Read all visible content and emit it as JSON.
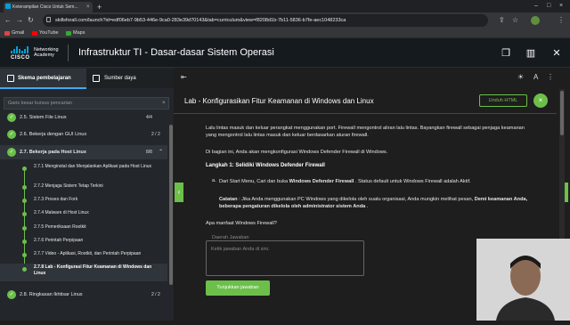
{
  "browser": {
    "tab_title": "Keterampilan Cisco Untuk Sem...",
    "url": "skillsforall.com/launch?id=edf06eb7-9b53-446e-9ca0-283e39d70143&tab=curriculum&view=f8208d1b-7b11-5836-b7fe-aec1048233ca",
    "bookmarks": [
      "Gmail",
      "YouTube",
      "Maps"
    ]
  },
  "header": {
    "logo_brand": "CISCO",
    "logo_sub": "Networking Academy",
    "course_title": "Infrastruktur TI - Dasar-dasar Sistem Operasi"
  },
  "sidebar": {
    "tab_active": "Skema pembelajaran",
    "tab_inactive": "Sumber daya",
    "search_placeholder": "Garis besar kursus pencarian",
    "items": [
      {
        "label": "2.5. Sistem File Linux",
        "count": "4/4"
      },
      {
        "label": "2.6. Bekerja dengan GUI Linux",
        "count": "2 / 2"
      },
      {
        "label": "2.7. Bekerja pada Host Linux",
        "count": "8/8"
      },
      {
        "label": "2.8. Ringkasan Ikhtisar Linux",
        "count": "2 / 2"
      }
    ],
    "subitems": [
      "2.7.1 Menginstal dan Menjalankan Aplikasi pada Host Linux",
      "2.7.2 Menjaga Sistem Tetap Terkini",
      "2.7.3 Proses dan Fork",
      "2.7.4 Malware di Host Linux",
      "2.7.5 Pemeriksaan Rootkit",
      "2.7.6 Perintah Perpipaan",
      "2.7.7 Video - Aplikasi, Rootkit, dan Perintah Perpipaan",
      "2.7.8 Lab - Konfigurasi Fitur Keamanan di Windows dan Linux"
    ]
  },
  "content": {
    "title": "Lab - Konfigurasikan Fitur Keamanan di Windows dan Linux",
    "download_label": "Unduh HTML",
    "para1": "Lalu lintas masuk dan keluar perangkat menggunakan port. Firewall mengontrol aliran lalu lintas. Bayangkan firewall sebagai penjaga keamanan yang mengontrol lalu lintas masuk dan keluar berdasarkan aturan firewall.",
    "para2": "Di bagian ini, Anda akan mengkonfigurasi Windows Defender Firewall di Windows.",
    "step_heading": "Langkah 1: Selidiki Windows Defender Firewall",
    "list_a": "Dari Start Menu, Cari dan buka Windows Defender Firewall . Status default untuk Windows Firewall adalah Aktif.",
    "list_a_b1": "Windows Defender Firewall",
    "note_label": "Catatan",
    "note_text": " : Jika Anda menggunakan PC Windows yang dikelola oleh suatu organisasi, Anda mungkin melihat pesan, ",
    "note_bold": "Demi keamanan Anda, beberapa pengaturan dikelola oleh administrator sistem Anda",
    "note_end": " .",
    "list_a_prefix": "Dari Start Menu, Cari dan buka ",
    "list_a_suffix": " . Status default untuk Windows Firewall adalah Aktif.",
    "list_marker": "a.",
    "question": "Apa manfaat Windows Firewall?",
    "answer_legend": "Daerah Jawaban",
    "answer_placeholder": "Ketik jawaban Anda di sini.",
    "show_answer_label": "Tunjukkan jawaban"
  }
}
